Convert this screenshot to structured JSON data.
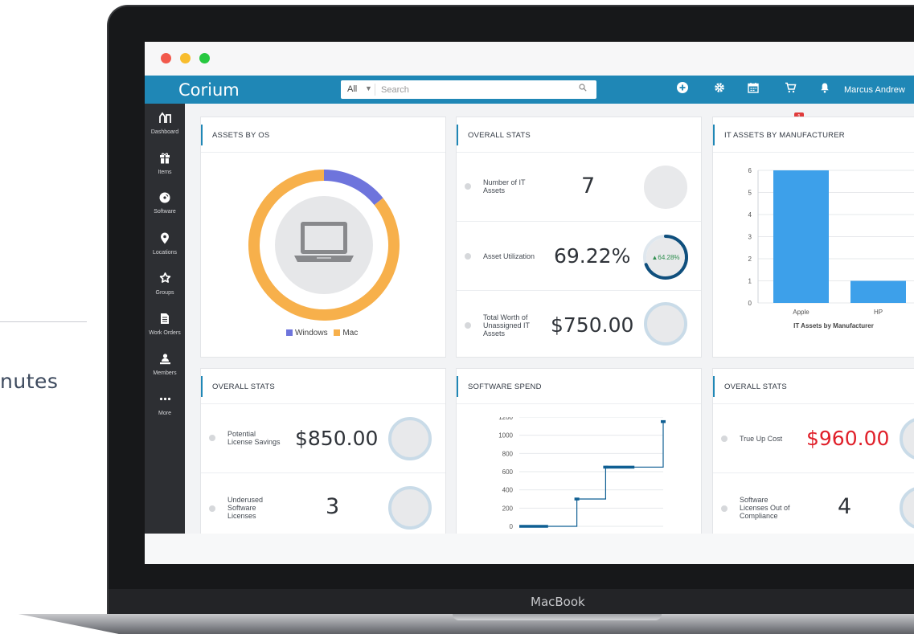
{
  "backdrop": {
    "caption_fragment": "nutes",
    "device_brand": "MacBook"
  },
  "app": {
    "name": "Corium"
  },
  "search": {
    "scope": "All",
    "placeholder": "Search"
  },
  "header": {
    "cart_count": "1",
    "user_name": "Marcus Andrew"
  },
  "sidebar": {
    "items": [
      {
        "label": "Dashboard",
        "icon": "dashboard-icon"
      },
      {
        "label": "Items",
        "icon": "gift-icon"
      },
      {
        "label": "Software",
        "icon": "disc-icon"
      },
      {
        "label": "Locations",
        "icon": "map-pin-icon"
      },
      {
        "label": "Groups",
        "icon": "groups-icon"
      },
      {
        "label": "Work Orders",
        "icon": "document-icon"
      },
      {
        "label": "Members",
        "icon": "members-icon"
      },
      {
        "label": "More",
        "icon": "more-icon"
      }
    ]
  },
  "cards": {
    "assets_by_os": {
      "title": "ASSETS BY OS",
      "legend": [
        {
          "label": "Windows",
          "color": "#6e74dc"
        },
        {
          "label": "Mac",
          "color": "#f7b04b"
        }
      ]
    },
    "overall_stats_1": {
      "title": "OVERALL STATS",
      "rows": [
        {
          "label_lines": [
            "Number of IT",
            "Assets"
          ],
          "value": "7"
        },
        {
          "label_lines": [
            "Asset Utilization"
          ],
          "value": "69.22%",
          "ring_label": "▲64.28%"
        },
        {
          "label_lines": [
            "Total Worth of",
            "Unassigned IT",
            "Assets"
          ],
          "value": "$750.00"
        }
      ]
    },
    "it_assets_by_manufacturer": {
      "title": "IT ASSETS BY MANUFACTURER",
      "chart_title": "IT Assets by Manufacturer"
    },
    "overall_stats_2": {
      "title": "OVERALL STATS",
      "rows": [
        {
          "label_lines": [
            "Potential",
            "License Savings"
          ],
          "value": "$850.00"
        },
        {
          "label_lines": [
            "Underused",
            "Software",
            "Licenses"
          ],
          "value": "3"
        }
      ]
    },
    "software_spend": {
      "title": "SOFTWARE SPEND"
    },
    "overall_stats_3": {
      "title": "OVERALL STATS",
      "rows": [
        {
          "label_lines": [
            "True Up Cost"
          ],
          "value": "$960.00"
        },
        {
          "label_lines": [
            "Software",
            "Licenses Out of",
            "Compliance"
          ],
          "value": "4"
        }
      ]
    }
  },
  "chart_data": [
    {
      "type": "pie",
      "title": "",
      "categories": [
        "Windows",
        "Mac"
      ],
      "values": [
        1,
        6
      ],
      "colors": [
        "#6e74dc",
        "#f7b04b"
      ],
      "legend": "bottom"
    },
    {
      "type": "bar",
      "title": "",
      "xlabel": "IT Assets by Manufacturer",
      "ylabel": "",
      "categories": [
        "Apple",
        "HP"
      ],
      "values": [
        6,
        1
      ],
      "ylim": [
        0,
        6
      ],
      "yticks": [
        0,
        1,
        2,
        3,
        4,
        5,
        6
      ],
      "color": "#3da0ea",
      "grid": true
    },
    {
      "type": "line",
      "title": "",
      "xlabel": "",
      "ylabel": "",
      "x": [
        0,
        1,
        2,
        3,
        4,
        5
      ],
      "y": [
        0,
        0,
        300,
        650,
        650,
        1150
      ],
      "step": true,
      "ylim": [
        0,
        1200
      ],
      "yticks": [
        0,
        200,
        400,
        600,
        800,
        1000,
        1200
      ],
      "color": "#0f5f93",
      "grid": true
    }
  ]
}
